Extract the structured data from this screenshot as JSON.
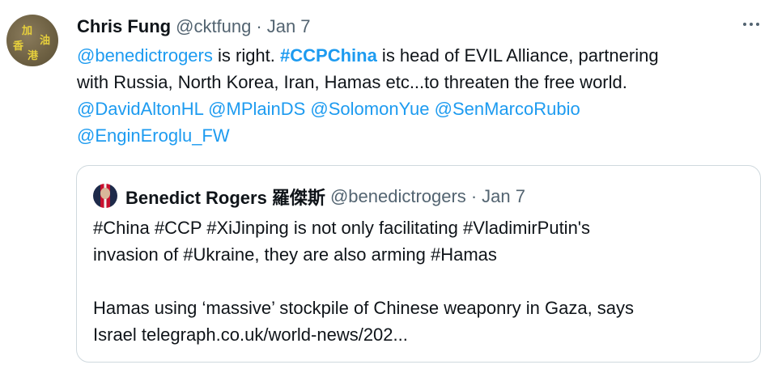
{
  "tweet": {
    "author_name": "Chris Fung",
    "author_handle": "@cktfung",
    "separator": "·",
    "date": "Jan 7",
    "avatar_chars": [
      "加",
      "油",
      "香",
      "港"
    ],
    "text": {
      "line1": {
        "mention": "@benedictrogers",
        "text1": " is right. ",
        "hashtag": "#CCPChina",
        "text2": " is head of EVIL Alliance, partnering"
      },
      "line2": "with Russia, North Korea, Iran, Hamas etc...to threaten the free world.",
      "line3_mentions": [
        "@DavidAltonHL",
        "@MPlainDS",
        "@SolomonYue",
        "@SenMarcoRubio"
      ],
      "line4_mention": "@EnginEroglu_FW"
    }
  },
  "quote": {
    "author_name": "Benedict Rogers 羅傑斯",
    "author_handle": "@benedictrogers",
    "separator": "·",
    "date": "Jan 7",
    "text_line1": "#China #CCP #XiJinping is not only facilitating #VladimirPutin's",
    "text_line2": "invasion of #Ukraine, they are also arming #Hamas",
    "text_line3": "Hamas using ‘massive’ stockpile of Chinese weaponry in Gaza, says",
    "text_line4": "Israel telegraph.co.uk/world-news/202..."
  },
  "colors": {
    "link": "#1d9bf0",
    "secondary": "#536471",
    "border": "#cfd9de"
  },
  "icons": {
    "more": "more-horizontal-icon"
  }
}
